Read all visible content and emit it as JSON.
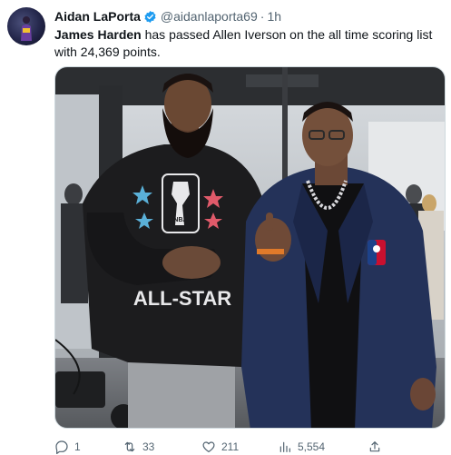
{
  "tweet": {
    "author_name": "Aidan LaPorta",
    "handle": "@aidanlaporta69",
    "separator": "·",
    "time": "1h",
    "text_bold": "James Harden",
    "text_rest": " has passed Allen Iverson on the all time scoring list with 24,369 points.",
    "verified_color": "#1d9bf0"
  },
  "photo": {
    "shirt_text_top": "NBA",
    "shirt_text_bottom": "ALL-STAR"
  },
  "actions": {
    "reply_count": "1",
    "retweet_count": "33",
    "like_count": "211",
    "views_count": "5,554"
  },
  "icons": {
    "reply": "reply-icon",
    "retweet": "retweet-icon",
    "like": "heart-icon",
    "views": "views-icon",
    "share": "share-icon"
  }
}
